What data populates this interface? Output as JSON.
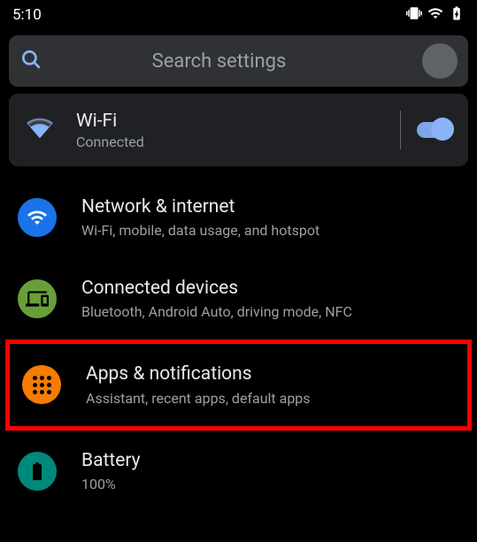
{
  "status": {
    "time": "5:10"
  },
  "search": {
    "placeholder": "Search settings"
  },
  "wifi_card": {
    "title": "Wi-Fi",
    "subtitle": "Connected"
  },
  "items": {
    "network": {
      "title": "Network & internet",
      "subtitle": "Wi-Fi, mobile, data usage, and hotspot"
    },
    "connected": {
      "title": "Connected devices",
      "subtitle": "Bluetooth, Android Auto, driving mode, NFC"
    },
    "apps": {
      "title": "Apps & notifications",
      "subtitle": "Assistant, recent apps, default apps"
    },
    "battery": {
      "title": "Battery",
      "subtitle": "100%"
    }
  }
}
